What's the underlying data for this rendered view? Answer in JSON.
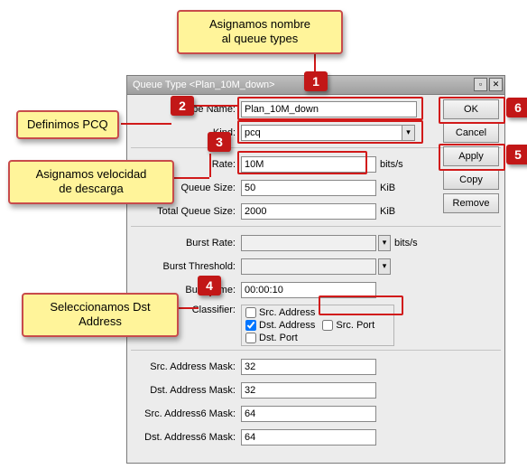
{
  "window": {
    "title": "Queue Type <Plan_10M_down>",
    "min_icon": "▫",
    "close_icon": "✕"
  },
  "fields": {
    "type_name": {
      "label": "Type Name:",
      "value": "Plan_10M_down"
    },
    "kind": {
      "label": "Kind:",
      "value": "pcq"
    },
    "rate": {
      "label": "Rate:",
      "value": "10M",
      "unit": "bits/s"
    },
    "queue_size": {
      "label": "Queue Size:",
      "value": "50",
      "unit": "KiB"
    },
    "total_queue_size": {
      "label": "Total Queue Size:",
      "value": "2000",
      "unit": "KiB"
    },
    "burst_rate": {
      "label": "Burst Rate:",
      "value": "",
      "unit": "bits/s"
    },
    "burst_threshold": {
      "label": "Burst Threshold:",
      "value": ""
    },
    "burst_time": {
      "label": "Burst Time:",
      "value": "00:00:10"
    },
    "classifier": {
      "label": "Classifier:",
      "src_address": "Src. Address",
      "dst_address": "Dst. Address",
      "src_port": "Src. Port",
      "dst_port": "Dst. Port",
      "src_address_checked": false,
      "dst_address_checked": true,
      "src_port_checked": false,
      "dst_port_checked": false
    },
    "src_mask": {
      "label": "Src. Address Mask:",
      "value": "32"
    },
    "dst_mask": {
      "label": "Dst. Address Mask:",
      "value": "32"
    },
    "src6_mask": {
      "label": "Src. Address6 Mask:",
      "value": "64"
    },
    "dst6_mask": {
      "label": "Dst. Address6 Mask:",
      "value": "64"
    }
  },
  "buttons": {
    "ok": "OK",
    "cancel": "Cancel",
    "apply": "Apply",
    "copy": "Copy",
    "remove": "Remove"
  },
  "callouts": {
    "c_assign_name": "Asignamos nombre\nal queue types",
    "c_pcq": "Definimos PCQ",
    "c_rate": "Asignamos velocidad\nde descarga",
    "c_dst": "Seleccionamos Dst\nAddress"
  },
  "badges": {
    "b1": "1",
    "b2": "2",
    "b3": "3",
    "b4": "4",
    "b5": "5",
    "b6": "6"
  }
}
